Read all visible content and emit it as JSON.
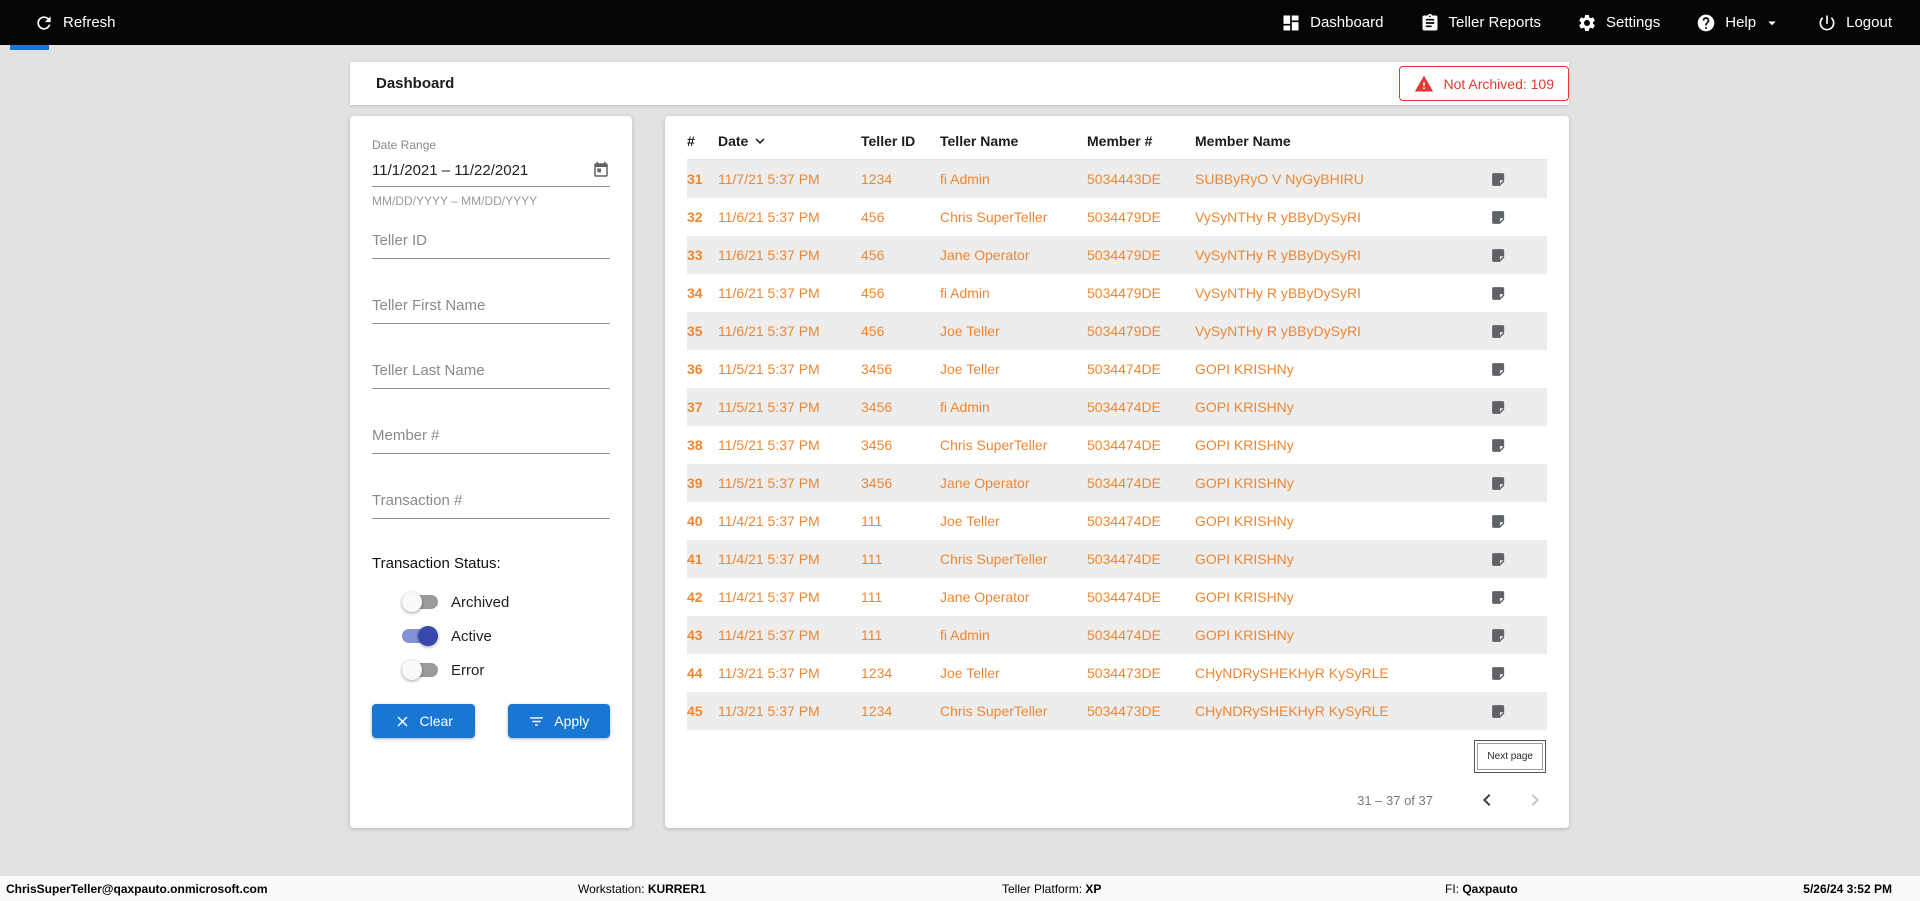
{
  "colors": {
    "topbar_bg": "#050505",
    "page_bg": "#E2E2E2",
    "accent_blue": "#1976D2",
    "row_text_orange": "#EF8632",
    "alert_red": "#E53935",
    "toggle_on_blue": "#3949AB",
    "stripe_gray": "#EDEDED"
  },
  "topbar": {
    "refresh_label": "Refresh",
    "items": [
      {
        "label": "Dashboard",
        "icon": "dashboard-icon"
      },
      {
        "label": "Teller Reports",
        "icon": "teller-reports-icon"
      },
      {
        "label": "Settings",
        "icon": "settings-gear-icon"
      },
      {
        "label": "Help",
        "icon": "help-icon"
      },
      {
        "label": "Logout",
        "icon": "logout-power-icon"
      }
    ]
  },
  "header": {
    "title": "Dashboard",
    "badge_label": "Not Archived: 109"
  },
  "filters": {
    "date_range": {
      "label": "Date Range",
      "value": "11/1/2021 – 11/22/2021",
      "hint": "MM/DD/YYYY – MM/DD/YYYY"
    },
    "fields": [
      {
        "placeholder": "Teller ID"
      },
      {
        "placeholder": "Teller First Name"
      },
      {
        "placeholder": "Teller Last Name"
      },
      {
        "placeholder": "Member #"
      },
      {
        "placeholder": "Transaction #"
      }
    ],
    "status": {
      "label": "Transaction Status:",
      "toggles": [
        {
          "label": "Archived",
          "on": false
        },
        {
          "label": "Active",
          "on": true
        },
        {
          "label": "Error",
          "on": false
        }
      ]
    },
    "buttons": {
      "clear": "Clear",
      "apply": "Apply"
    }
  },
  "table": {
    "columns": [
      "#",
      "Date",
      "Teller ID",
      "Teller Name",
      "Member #",
      "Member Name"
    ],
    "rows": [
      {
        "num": "31",
        "date": "11/7/21 5:37 PM",
        "teller_id": "1234",
        "teller_name": "fi Admin",
        "member_num": "5034443DE",
        "member_name": "SUBByRyO V NyGyBHIRU"
      },
      {
        "num": "32",
        "date": "11/6/21 5:37 PM",
        "teller_id": "456",
        "teller_name": "Chris SuperTeller",
        "member_num": "5034479DE",
        "member_name": "VySyNTHy R yBByDySyRI"
      },
      {
        "num": "33",
        "date": "11/6/21 5:37 PM",
        "teller_id": "456",
        "teller_name": "Jane Operator",
        "member_num": "5034479DE",
        "member_name": "VySyNTHy R yBByDySyRI"
      },
      {
        "num": "34",
        "date": "11/6/21 5:37 PM",
        "teller_id": "456",
        "teller_name": "fi Admin",
        "member_num": "5034479DE",
        "member_name": "VySyNTHy R yBByDySyRI"
      },
      {
        "num": "35",
        "date": "11/6/21 5:37 PM",
        "teller_id": "456",
        "teller_name": "Joe Teller",
        "member_num": "5034479DE",
        "member_name": "VySyNTHy R yBByDySyRI"
      },
      {
        "num": "36",
        "date": "11/5/21 5:37 PM",
        "teller_id": "3456",
        "teller_name": "Joe Teller",
        "member_num": "5034474DE",
        "member_name": "GOPI KRISHNy"
      },
      {
        "num": "37",
        "date": "11/5/21 5:37 PM",
        "teller_id": "3456",
        "teller_name": "fi Admin",
        "member_num": "5034474DE",
        "member_name": "GOPI KRISHNy"
      },
      {
        "num": "38",
        "date": "11/5/21 5:37 PM",
        "teller_id": "3456",
        "teller_name": "Chris SuperTeller",
        "member_num": "5034474DE",
        "member_name": "GOPI KRISHNy"
      },
      {
        "num": "39",
        "date": "11/5/21 5:37 PM",
        "teller_id": "3456",
        "teller_name": "Jane Operator",
        "member_num": "5034474DE",
        "member_name": "GOPI KRISHNy"
      },
      {
        "num": "40",
        "date": "11/4/21 5:37 PM",
        "teller_id": "111",
        "teller_name": "Joe Teller",
        "member_num": "5034474DE",
        "member_name": "GOPI KRISHNy"
      },
      {
        "num": "41",
        "date": "11/4/21 5:37 PM",
        "teller_id": "111",
        "teller_name": "Chris SuperTeller",
        "member_num": "5034474DE",
        "member_name": "GOPI KRISHNy"
      },
      {
        "num": "42",
        "date": "11/4/21 5:37 PM",
        "teller_id": "111",
        "teller_name": "Jane Operator",
        "member_num": "5034474DE",
        "member_name": "GOPI KRISHNy"
      },
      {
        "num": "43",
        "date": "11/4/21 5:37 PM",
        "teller_id": "111",
        "teller_name": "fi Admin",
        "member_num": "5034474DE",
        "member_name": "GOPI KRISHNy"
      },
      {
        "num": "44",
        "date": "11/3/21 5:37 PM",
        "teller_id": "1234",
        "teller_name": "Joe Teller",
        "member_num": "5034473DE",
        "member_name": "CHyNDRySHEKHyR KySyRLE"
      },
      {
        "num": "45",
        "date": "11/3/21 5:37 PM",
        "teller_id": "1234",
        "teller_name": "Chris SuperTeller",
        "member_num": "5034473DE",
        "member_name": "CHyNDRySHEKHyR KySyRLE"
      }
    ],
    "pagination": {
      "next_label": "Next page",
      "range_label": "31 – 37 of 37"
    }
  },
  "footer": {
    "user": "ChrisSuperTeller@qaxpauto.onmicrosoft.com",
    "workstation_label": "Workstation:",
    "workstation_value": "KURRER1",
    "platform_label": "Teller Platform:",
    "platform_value": "XP",
    "fi_label": "FI:",
    "fi_value": "Qaxpauto",
    "datetime": "5/26/24 3:52 PM"
  }
}
